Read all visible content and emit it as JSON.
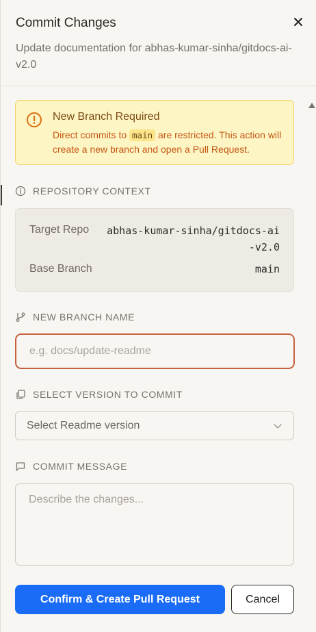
{
  "dialog": {
    "title": "Commit Changes",
    "subtitle": "Update documentation for abhas-kumar-sinha/gitdocs-ai-v2.0",
    "close_icon": "close-icon"
  },
  "warning": {
    "icon": "alert-circle-icon",
    "title": "New Branch Required",
    "text_before": "Direct commits to ",
    "branch_code": "main",
    "text_after": " are restricted. This action will create a new branch and open a Pull Request.",
    "colors": {
      "background": "#fef5c4",
      "border": "#f2d46b",
      "text": "#c25613"
    }
  },
  "context": {
    "label": "REPOSITORY CONTEXT",
    "icon": "info-icon",
    "target_repo_label": "Target Repo",
    "target_repo_value": "abhas-kumar-sinha/gitdocs-ai-v2.0",
    "base_branch_label": "Base Branch",
    "base_branch_value": "main"
  },
  "branch": {
    "label": "NEW BRANCH NAME",
    "icon": "git-branch-icon",
    "placeholder": "e.g. docs/update-readme",
    "value": ""
  },
  "version": {
    "label": "SELECT VERSION TO COMMIT",
    "icon": "copy-icon",
    "selected": "Select Readme version",
    "chevron": "chevron-down-icon"
  },
  "message": {
    "label": "COMMIT MESSAGE",
    "icon": "message-square-icon",
    "placeholder": "Describe the changes..."
  },
  "actions": {
    "confirm_label": "Confirm & Create Pull Request",
    "cancel_label": "Cancel",
    "accent": "#1a6cf6"
  }
}
